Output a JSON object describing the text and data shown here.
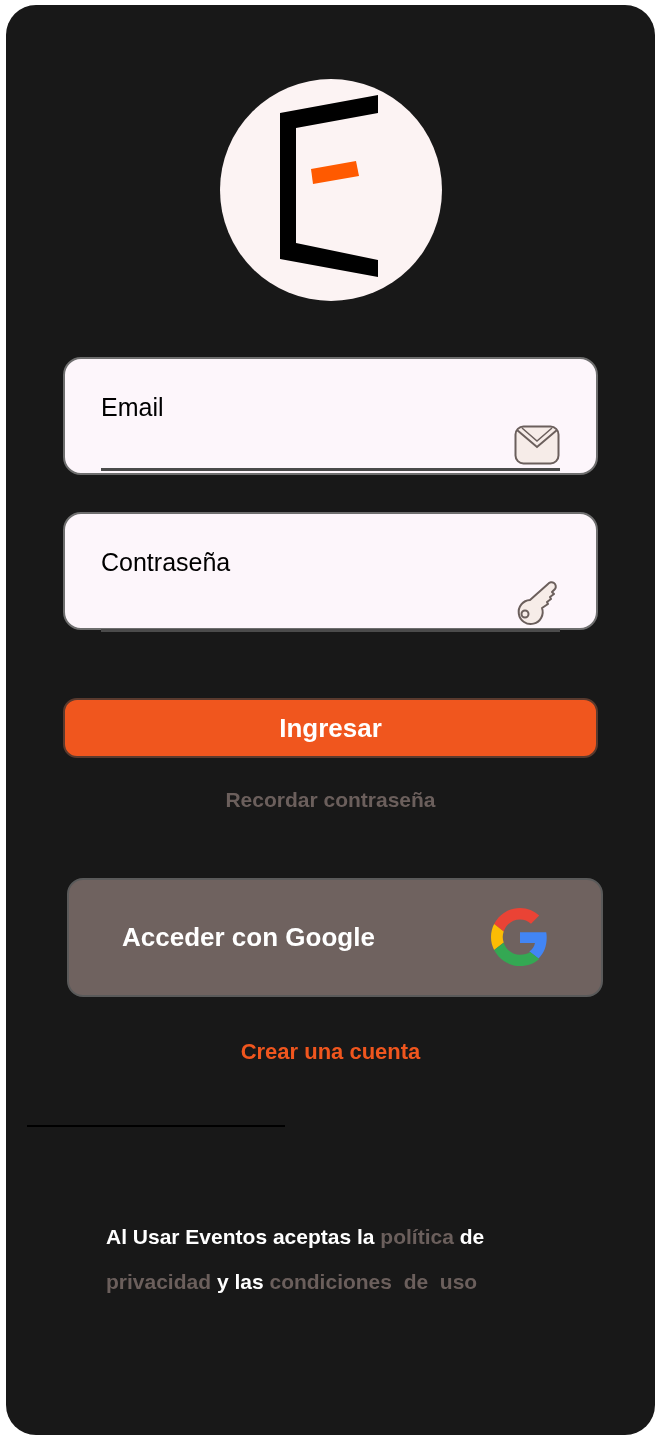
{
  "fields": [
    {
      "kind": "email",
      "label": "Email"
    },
    {
      "kind": "password",
      "label": "Contraseña"
    }
  ],
  "login_button": "Ingresar",
  "forgot_link": "Recordar contraseña",
  "google_button": "Acceder con Google",
  "signup_link": "Crear una cuenta",
  "legal": [
    {
      "kind": "plain",
      "text": "Al Usar Eventos aceptas la"
    },
    {
      "kind": "link",
      "text": "política"
    },
    {
      "kind": "plain",
      "text": "de"
    },
    {
      "kind": "link",
      "text": "privacidad"
    },
    {
      "kind": "plain",
      "text": "y las"
    },
    {
      "kind": "link",
      "text": "condiciones  de  uso"
    }
  ]
}
